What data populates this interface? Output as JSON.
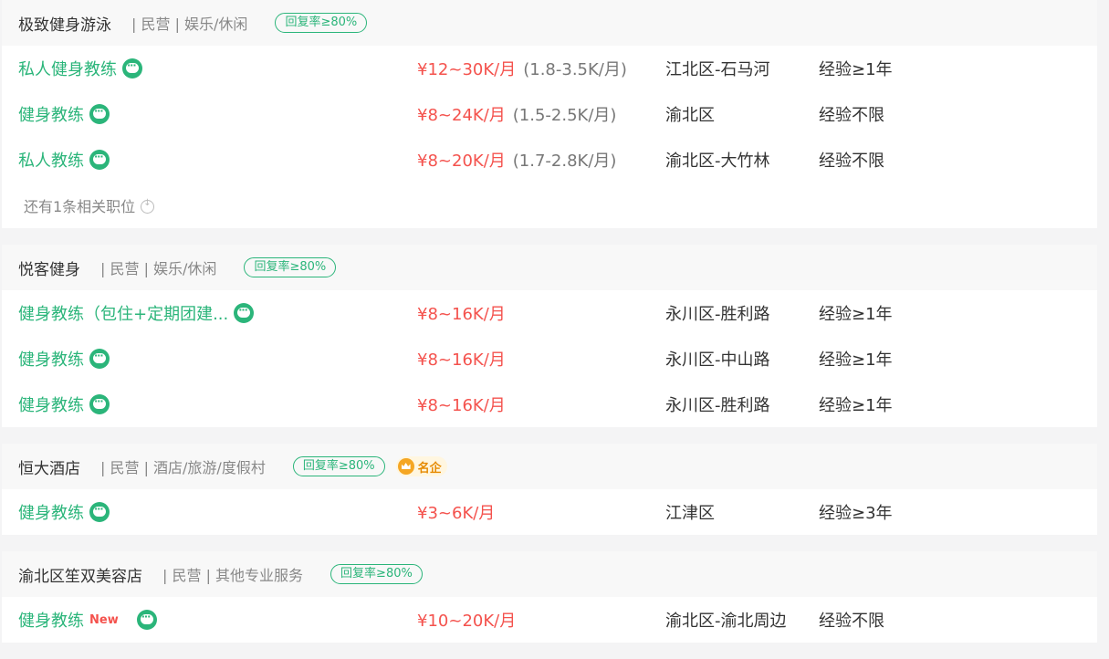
{
  "companies": [
    {
      "name": "极致健身游泳",
      "meta": "| 民营 | 娱乐/休闲",
      "badge": "回复率≥80%",
      "jobs": [
        {
          "title": "私人健身教练",
          "salary": "¥12~30K/月",
          "daily": "(1.8-3.5K/月)",
          "location": "江北区-石马河",
          "experience": "经验≥1年"
        },
        {
          "title": "健身教练",
          "salary": "¥8~24K/月",
          "daily": "(1.5-2.5K/月)",
          "location": "渝北区",
          "experience": "经验不限"
        },
        {
          "title": "私人教练",
          "salary": "¥8~20K/月",
          "daily": "(1.7-2.8K/月)",
          "location": "渝北区-大竹林",
          "experience": "经验不限"
        }
      ],
      "more": "还有1条相关职位"
    },
    {
      "name": "悦客健身",
      "meta": "| 民营 | 娱乐/休闲",
      "badge": "回复率≥80%",
      "jobs": [
        {
          "title": "健身教练（包住+定期团建...",
          "salary": "¥8~16K/月",
          "location": "永川区-胜利路",
          "experience": "经验≥1年"
        },
        {
          "title": "健身教练",
          "salary": "¥8~16K/月",
          "location": "永川区-中山路",
          "experience": "经验≥1年"
        },
        {
          "title": "健身教练",
          "salary": "¥8~16K/月",
          "location": "永川区-胜利路",
          "experience": "经验≥1年"
        }
      ]
    },
    {
      "name": "恒大酒店",
      "meta": "| 民营 | 酒店/旅游/度假村",
      "badge": "回复率≥80%",
      "famous_tag": "名企",
      "jobs": [
        {
          "title": "健身教练",
          "salary": "¥3~6K/月",
          "location": "江津区",
          "experience": "经验≥3年"
        }
      ]
    },
    {
      "name": "渝北区笙双美容店",
      "meta": "| 民营 | 其他专业服务",
      "badge": "回复率≥80%",
      "jobs": [
        {
          "title": "健身教练",
          "new_tag": "New",
          "salary": "¥10~20K/月",
          "location": "渝北区-渝北周边",
          "experience": "经验不限"
        }
      ]
    }
  ],
  "colors": {
    "accent": "#2bb57a",
    "salary": "#f4524d",
    "famous": "#f5a623"
  },
  "icons": {
    "chat": "chat-bubble-icon",
    "famous": "crown-icon",
    "more": "arrow-down-circle-icon"
  }
}
